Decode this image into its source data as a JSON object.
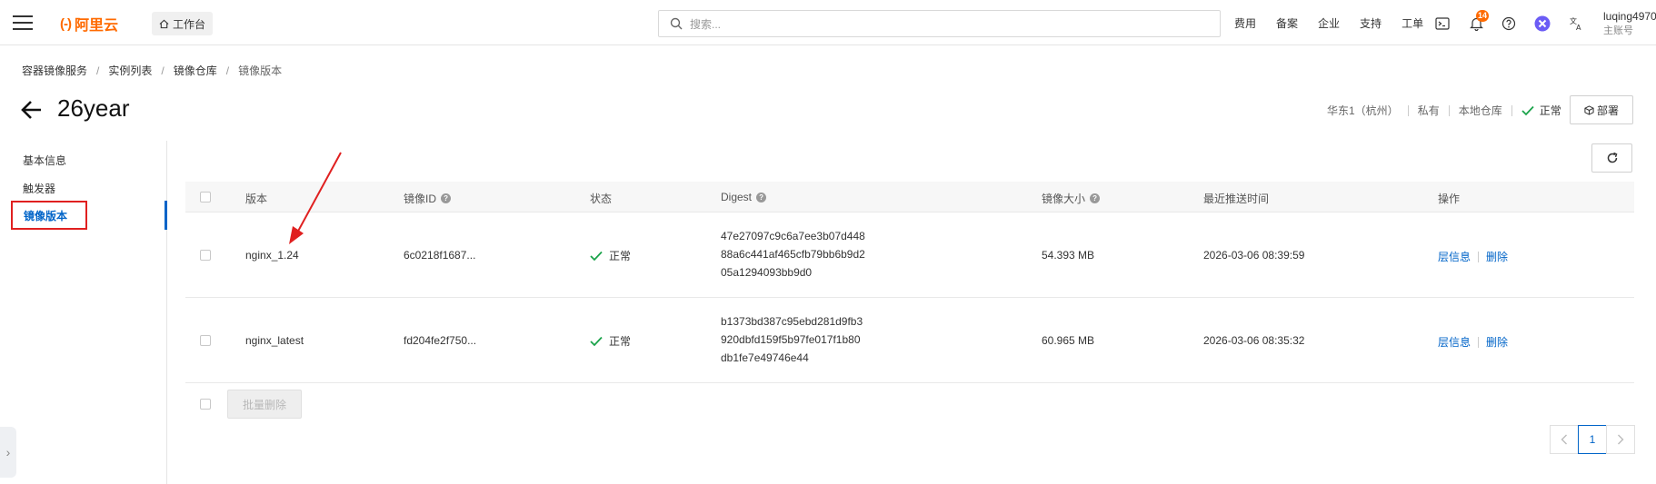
{
  "topbar": {
    "logo_text": "阿里云",
    "logo_bracket": "(-)",
    "workbench_label": "工作台",
    "search_placeholder": "搜索...",
    "links": [
      "费用",
      "备案",
      "企业",
      "支持",
      "工单"
    ],
    "notification_count": "14",
    "user_name": "luqing4970",
    "user_sub": "主账号"
  },
  "breadcrumb": [
    "容器镜像服务",
    "实例列表",
    "镜像仓库",
    "镜像版本"
  ],
  "page": {
    "title": "26year",
    "region": "华东1（杭州）",
    "visibility": "私有",
    "repo_type": "本地仓库",
    "status": "正常",
    "deploy_label": "部署"
  },
  "sidenav": {
    "items": [
      "基本信息",
      "触发器",
      "镜像版本"
    ],
    "active": "镜像版本"
  },
  "table": {
    "headers": {
      "version": "版本",
      "image_id": "镜像ID",
      "status": "状态",
      "digest": "Digest",
      "size": "镜像大小",
      "pushed": "最近推送时间",
      "actions": "操作"
    },
    "rows": [
      {
        "version": "nginx_1.24",
        "image_id": "6c0218f1687...",
        "status": "正常",
        "digest_1": "47e27097c9c6a7ee3b07d448",
        "digest_2": "88a6c441af465cfb79bb6b9d2",
        "digest_3": "05a1294093bb9d0",
        "size": "54.393 MB",
        "pushed": "2026-03-06 08:39:59",
        "action_info": "层信息",
        "action_delete": "删除"
      },
      {
        "version": "nginx_latest",
        "image_id": "fd204fe2f750...",
        "status": "正常",
        "digest_1": "b1373bd387c95ebd281d9fb3",
        "digest_2": "920dbfd159f5b97fe017f1b80",
        "digest_3": "db1fe7e49746e44",
        "size": "60.965 MB",
        "pushed": "2026-03-06 08:35:32",
        "action_info": "层信息",
        "action_delete": "删除"
      }
    ],
    "bulk_delete_label": "批量删除"
  },
  "pagination": {
    "current_page": "1"
  },
  "colors": {
    "brand": "#ff6a00",
    "link": "#0064c8",
    "ok": "#1aa34a",
    "annotation": "#e02020"
  }
}
